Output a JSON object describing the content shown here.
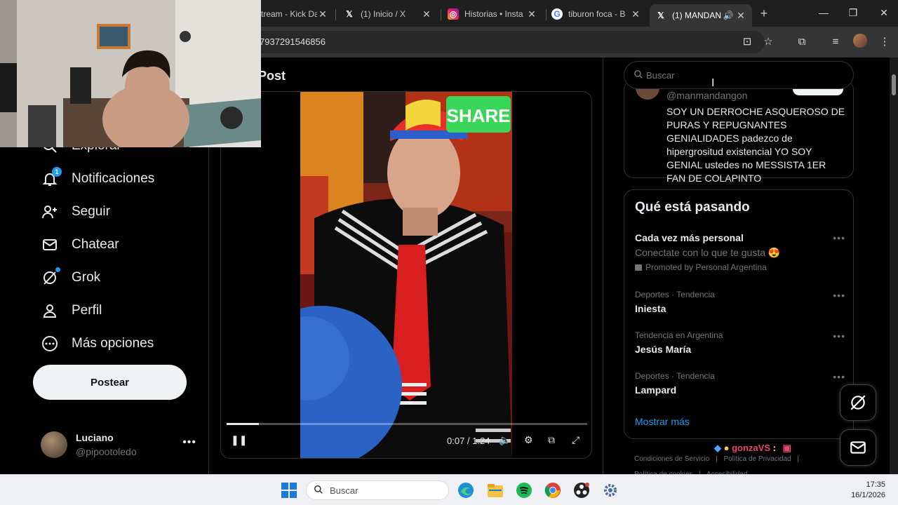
{
  "browser": {
    "tabs": [
      {
        "title": "tream - Kick Da",
        "icon": "kick-icon"
      },
      {
        "title": "(1) Inicio / X",
        "icon": "x-icon"
      },
      {
        "title": "Historias • Insta",
        "icon": "instagram-icon"
      },
      {
        "title": "tiburon foca - B",
        "icon": "google-icon"
      },
      {
        "title": "(1) MANDAN",
        "icon": "x-icon",
        "active": true
      }
    ],
    "url": "7937291546856"
  },
  "nav": {
    "items": [
      {
        "label": "Explorar",
        "icon": "search-icon"
      },
      {
        "label": "Notificaciones",
        "icon": "bell-icon",
        "badge": "1"
      },
      {
        "label": "Seguir",
        "icon": "follow-icon"
      },
      {
        "label": "Chatear",
        "icon": "mail-icon"
      },
      {
        "label": "Grok",
        "icon": "grok-icon"
      },
      {
        "label": "Perfil",
        "icon": "person-icon"
      },
      {
        "label": "Más opciones",
        "icon": "more-circle-icon"
      }
    ],
    "post_button": "Postear",
    "account": {
      "name": "Luciano",
      "handle": "@pipootoledo"
    }
  },
  "main": {
    "heading": "Post",
    "video": {
      "sticker": "SHARE",
      "time": "0:07 / 1:24",
      "progress": 0.09
    }
  },
  "right": {
    "search_placeholder": "Buscar",
    "tweet": {
      "handle": "@manmandangon",
      "text": "SOY UN DERROCHE ASQUEROSO DE PURAS Y REPUGNANTES GENIALIDADES padezco de hipergrositud existencial YO SOY GENIAL ustedes no MESSISTA 1ER FAN DE COLAPINTO"
    },
    "trends_title": "Qué está pasando",
    "trends": [
      {
        "name": "Cada vez más personal",
        "sub": "Conectate con lo que te gusta 😍",
        "promo": "Promoted by Personal Argentina"
      },
      {
        "meta": "Deportes · Tendencia",
        "name": "Iniesta"
      },
      {
        "meta": "Tendencia en Argentina",
        "name": "Jesús María"
      },
      {
        "meta": "Deportes · Tendencia",
        "name": "Lampard"
      }
    ],
    "show_more": "Mostrar más",
    "footer": [
      "Condiciones de Servicio",
      "Política de Privacidad",
      "Política de cookies",
      "Accesibilidad"
    ]
  },
  "overlay": {
    "chat_user": "gonzaVS",
    "chat_sep": ":"
  },
  "taskbar": {
    "search_placeholder": "Buscar",
    "time": "17:35",
    "date": "16/1/2026"
  }
}
